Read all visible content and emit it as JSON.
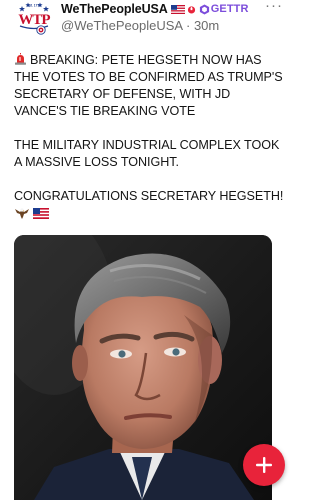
{
  "post": {
    "author": {
      "display_name": "WeThePeopleUSA",
      "handle": "@WeThePeopleUSA",
      "time": "30m",
      "platform_badge": "GETTR",
      "avatar_icon": "wtp-logo-icon",
      "avatar_text": "WTP",
      "avatar_text_small": "Est. 1776"
    },
    "more_label": "···",
    "paragraphs": [
      "BREAKING: PETE HEGSETH NOW HAS THE VOTES TO BE CONFIRMED AS TRUMP'S SECRETARY OF DEFENSE, WITH JD VANCE'S TIE BREAKING VOTE",
      "THE MILITARY INDUSTRIAL COMPLEX TOOK A MASSIVE LOSS TONIGHT.",
      "CONGRATULATIONS SECRETARY HEGSETH!"
    ],
    "icons": {
      "breaking": "siren-icon",
      "eagle": "eagle-icon",
      "flag": "us-flag-icon",
      "fab": "plus-icon"
    },
    "image": {
      "subject": "man-portrait-photo"
    }
  },
  "colors": {
    "fab": "#e8233a",
    "gettr_purple": "#7c4ddb",
    "handle_gray": "#6b6b6b"
  }
}
